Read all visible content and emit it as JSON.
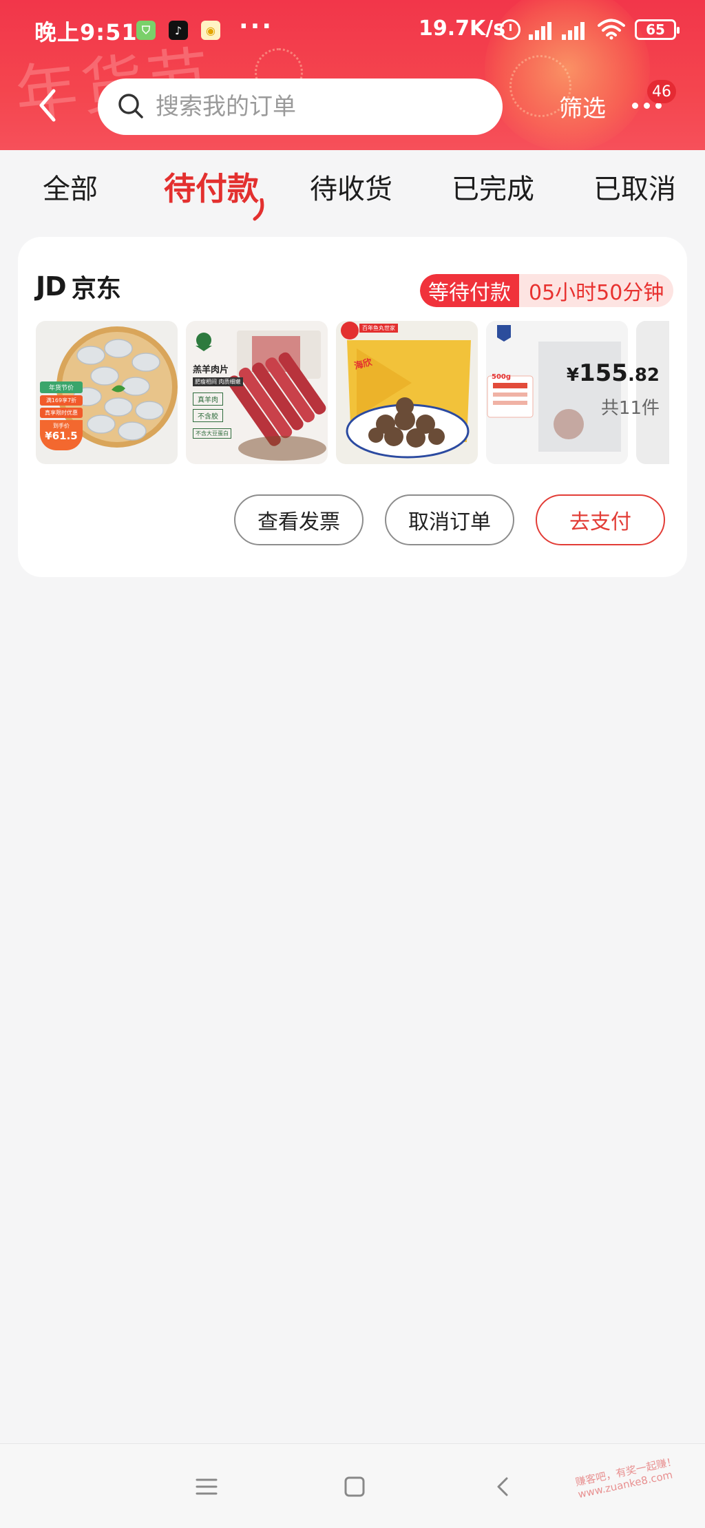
{
  "status_bar": {
    "time": "晚上9:51",
    "more_dots": "···",
    "net_speed": "19.7K/s",
    "battery": "65"
  },
  "header": {
    "search_placeholder": "搜索我的订单",
    "filter_label": "筛选",
    "more_badge": "46",
    "deco_text": "年货节"
  },
  "tabs": [
    {
      "label": "全部"
    },
    {
      "label": "待付款",
      "active": true
    },
    {
      "label": "待收货"
    },
    {
      "label": "已完成"
    },
    {
      "label": "已取消"
    }
  ],
  "order": {
    "shop_logo": "JD",
    "shop_name": "京东",
    "status_label": "等待付款",
    "countdown": "05小时50分钟",
    "price_currency": "¥",
    "price_int": "155",
    "price_dec": ".82",
    "item_count": "共11件",
    "products": [
      {
        "name": "shrimp",
        "promo_tag": "年货节价",
        "promo_line1": "满169享7折",
        "promo_line2": "真享限时优惠",
        "promo_price_label": "到手价",
        "promo_price": "¥61.5"
      },
      {
        "name": "lamb-slices",
        "title": "羔羊肉片",
        "sub": "肥瘦相间 肉质细嫩",
        "tag1": "真羊肉",
        "tag2": "不含胶",
        "tag3": "不含大豆蛋白"
      },
      {
        "name": "fish-balls",
        "banner": "百年鱼丸世家",
        "brand": "海欣"
      },
      {
        "name": "frozen-food",
        "badge": "500g"
      },
      {
        "name": "extra-item"
      }
    ],
    "actions": {
      "invoice": "查看发票",
      "cancel": "取消订单",
      "pay": "去支付"
    }
  },
  "watermark": {
    "line1": "赚客吧，有奖一起赚！",
    "line2": "www.zuanke8.com"
  },
  "colors": {
    "brand_red": "#e3302f",
    "header_red": "#f2364a",
    "status_pill": "#f0323b",
    "timer_bg": "#fde4e2"
  }
}
